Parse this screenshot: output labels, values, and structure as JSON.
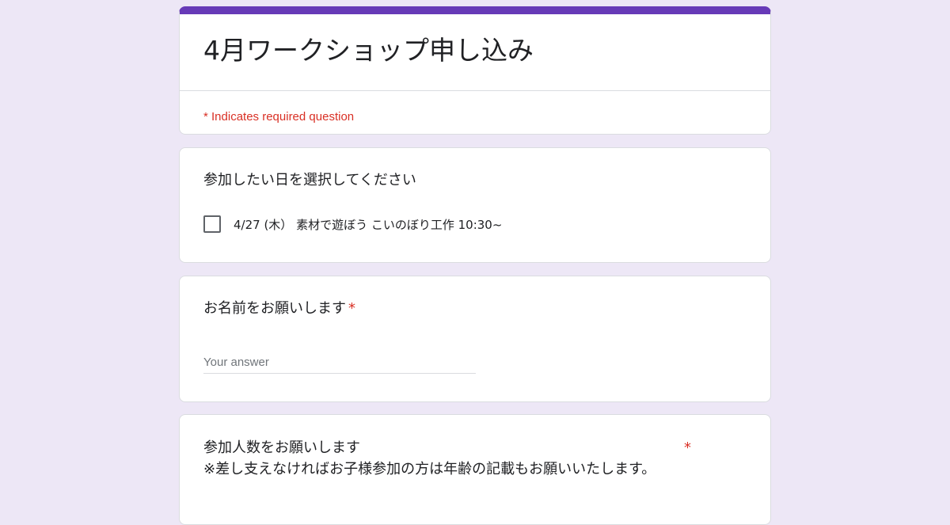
{
  "form": {
    "title": "4月ワークショップ申し込み",
    "required_note": "* Indicates required question",
    "accent_color": "#673ab7",
    "background_color": "#ede7f6",
    "required_color": "#d93025"
  },
  "questions": [
    {
      "title": "参加したい日を選択してください",
      "type": "checkbox",
      "required": false,
      "options": [
        {
          "label": "4/27 (木）  素材で遊ぼう こいのぼり工作 10:30~",
          "checked": false
        }
      ]
    },
    {
      "title": "お名前をお願いします",
      "type": "short-answer",
      "required": true,
      "required_marker": "*",
      "placeholder": "Your answer",
      "value": ""
    },
    {
      "title": "参加人数をお願いします",
      "description": "※差し支えなければお子様参加の方は年齢の記載もお願いいたします。",
      "type": "short-answer",
      "required": true,
      "required_marker": "*"
    }
  ]
}
